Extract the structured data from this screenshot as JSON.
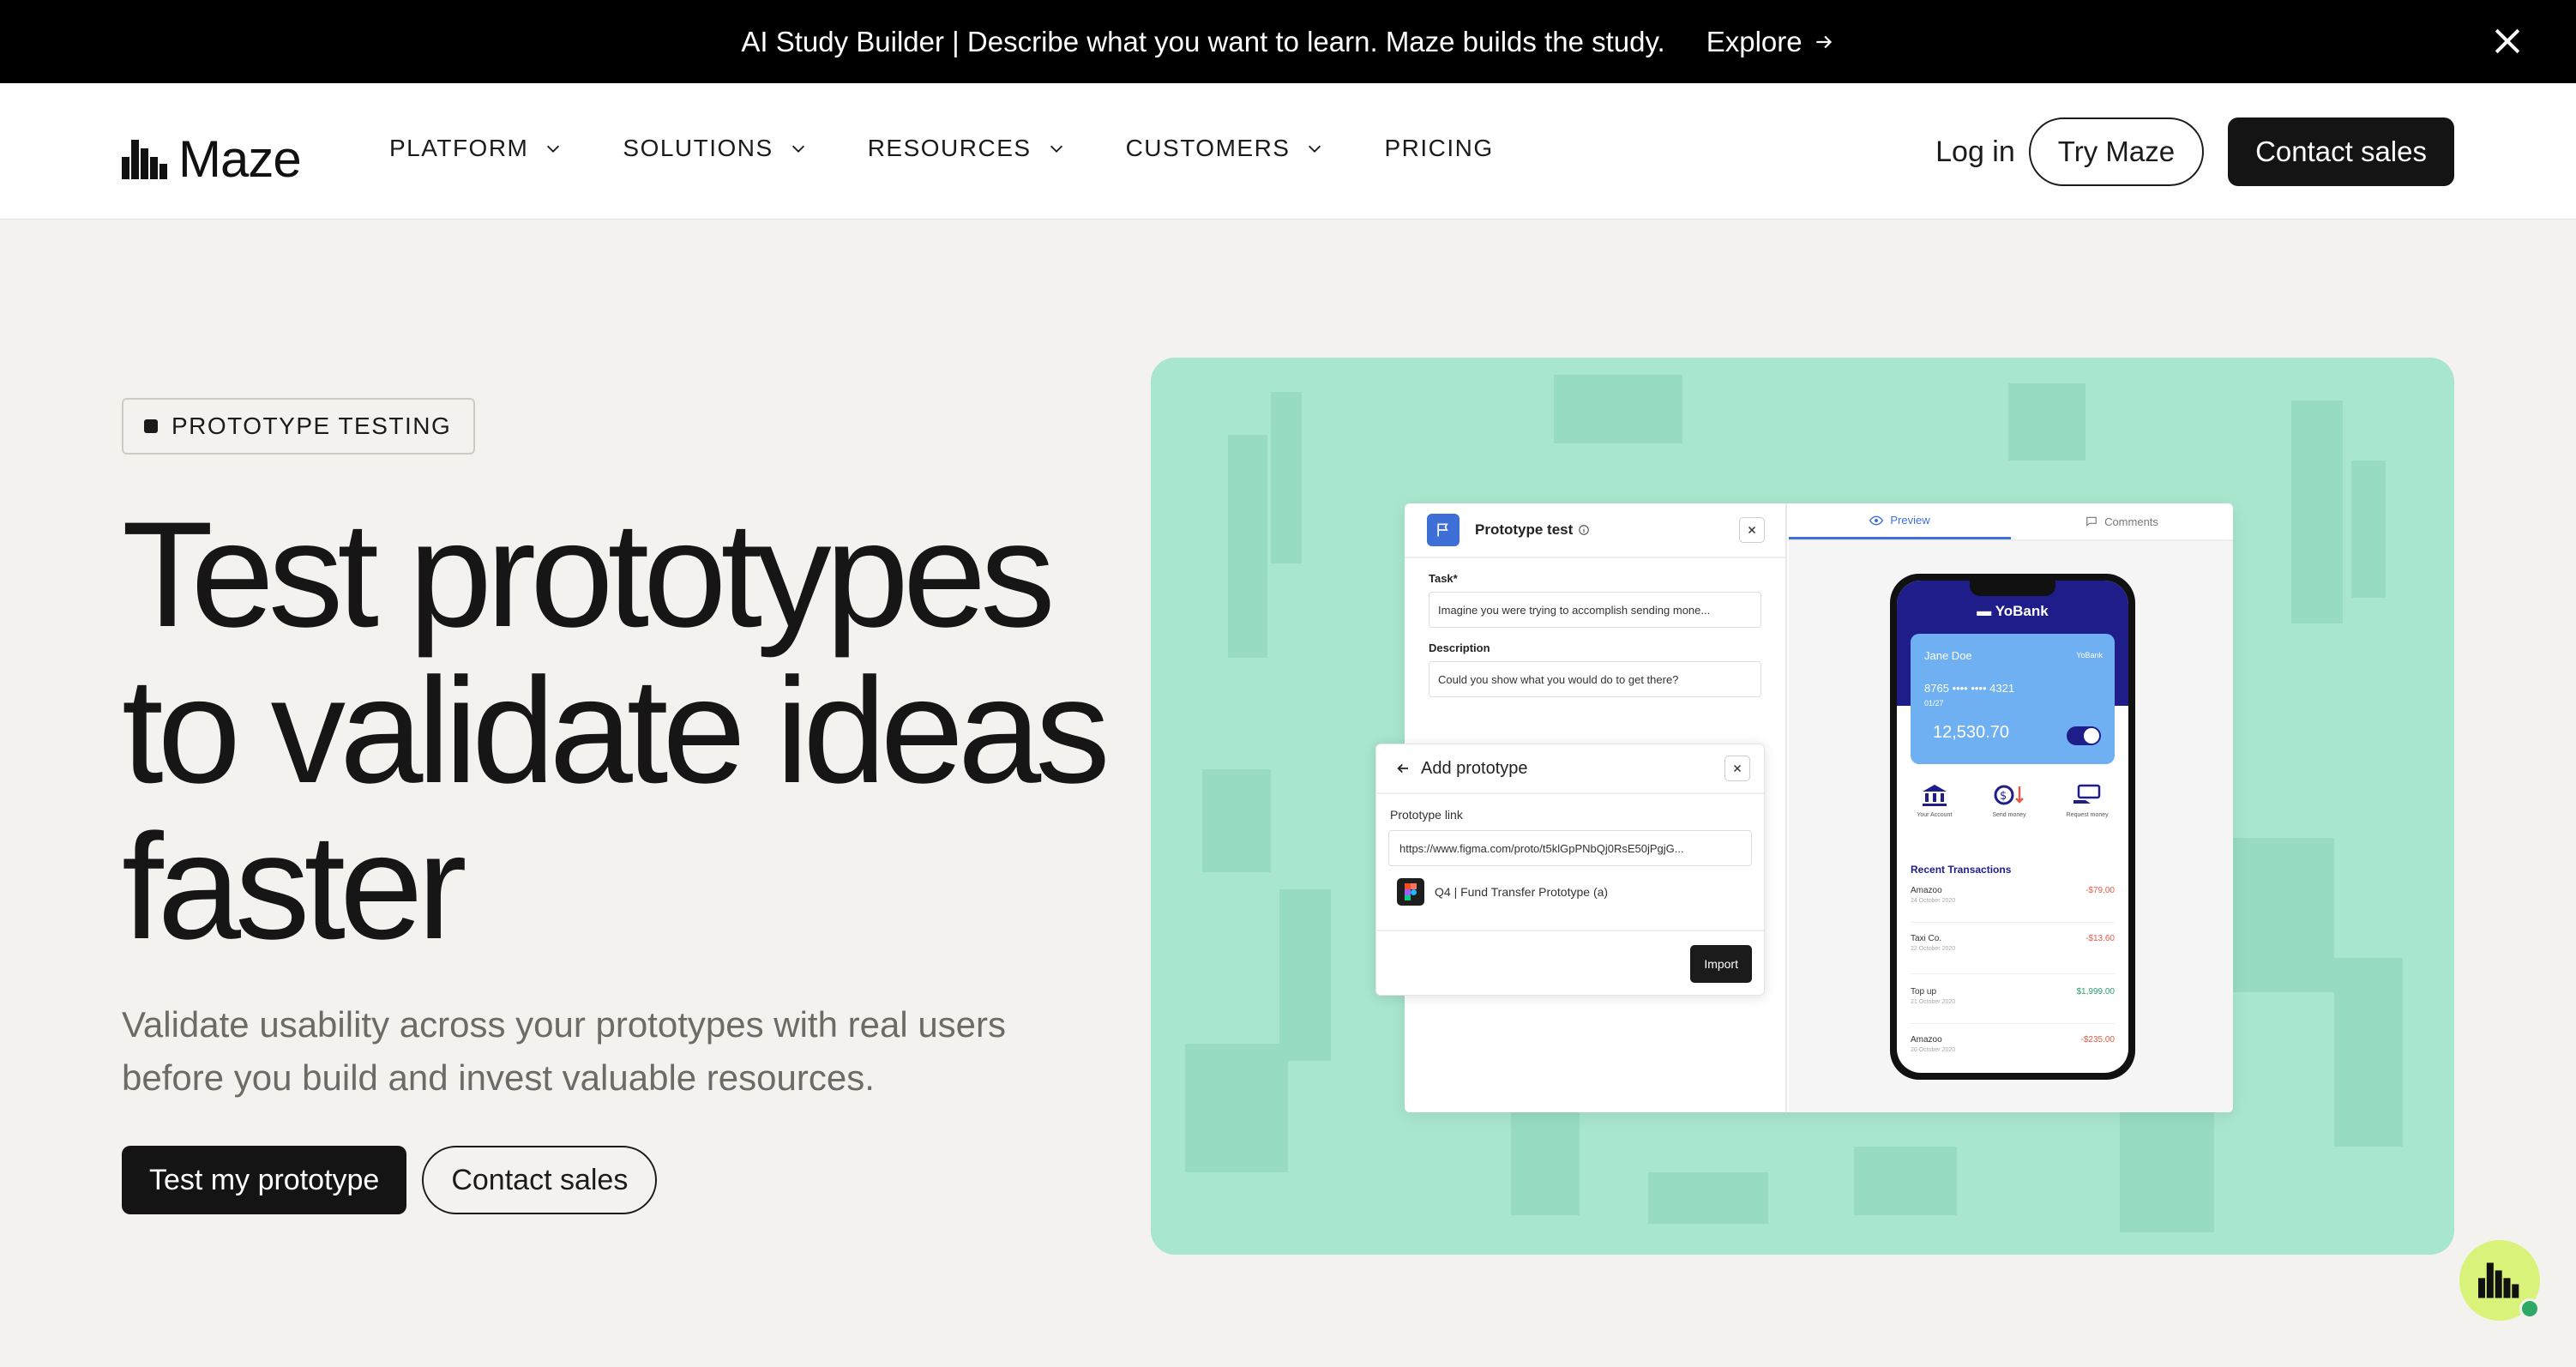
{
  "announcement": {
    "text": "AI Study Builder | Describe what you want to learn. Maze builds the study.",
    "explore_label": "Explore"
  },
  "nav": {
    "logo_text": "Maze",
    "menu": [
      {
        "label": "PLATFORM",
        "has_dropdown": true
      },
      {
        "label": "SOLUTIONS",
        "has_dropdown": true
      },
      {
        "label": "RESOURCES",
        "has_dropdown": true
      },
      {
        "label": "CUSTOMERS",
        "has_dropdown": true
      },
      {
        "label": "PRICING",
        "has_dropdown": false
      }
    ],
    "login_label": "Log in",
    "try_label": "Try Maze",
    "contact_label": "Contact sales"
  },
  "hero": {
    "tag": "PROTOTYPE TESTING",
    "title": "Test prototypes to validate ideas faster",
    "subtitle": "Validate usability across your prototypes with real users before you build and invest valuable resources.",
    "cta_primary": "Test my prototype",
    "cta_secondary": "Contact sales"
  },
  "mockup": {
    "ptest_title": "Prototype test",
    "task_label": "Task*",
    "task_value": "Imagine you were trying to accomplish sending mone...",
    "desc_label": "Description",
    "desc_value": "Could you show what you would do to get there?",
    "add_title": "Add prototype",
    "link_label": "Prototype link",
    "link_value": "https://www.figma.com/proto/t5klGpPNbQj0RsE50jPgjG...",
    "file_name": "Q4 | Fund Transfer Prototype (a)",
    "import_label": "Import",
    "tab_preview": "Preview",
    "tab_comments": "Comments",
    "bank": {
      "name": "YoBank",
      "holder": "Jane Doe",
      "brand": "YoBank",
      "card_number": "8765 •••• •••• 4321",
      "expiry": "01/27",
      "balance": "12,530.70",
      "actions": [
        "Your Account",
        "Send money",
        "Request money"
      ],
      "transactions_title": "Recent Transactions",
      "transactions": [
        {
          "name": "Amazoo",
          "date": "24 October 2020",
          "amount": "-$79.00",
          "type": "neg"
        },
        {
          "name": "Taxi Co.",
          "date": "22 October 2020",
          "amount": "-$13.60",
          "type": "neg"
        },
        {
          "name": "Top up",
          "date": "21 October 2020",
          "amount": "$1,999.00",
          "type": "pos"
        },
        {
          "name": "Amazoo",
          "date": "20 October 2020",
          "amount": "-$235.00",
          "type": "neg"
        }
      ]
    }
  },
  "colors": {
    "panel_bg": "#a8e6cd",
    "accent_blue": "#3d6fd6",
    "bank_navy": "#1f1d8a",
    "chat_bubble": "#d9f27a"
  }
}
